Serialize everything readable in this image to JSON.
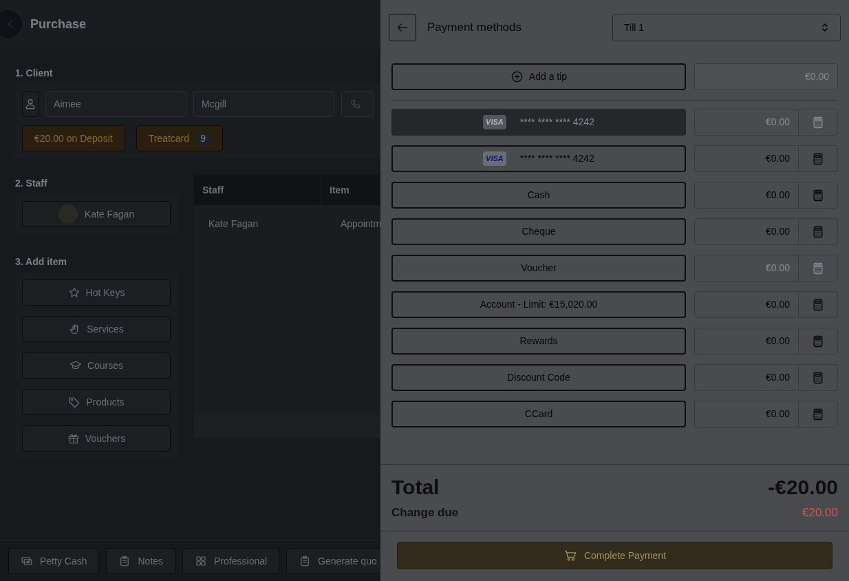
{
  "page": {
    "title": "Purchase",
    "client": {
      "label": "1. Client",
      "first_name": "Aimee",
      "last_name": "Mcgill",
      "badges": [
        {
          "kind": "deposit",
          "text": "€20.00 on Deposit"
        },
        {
          "kind": "count",
          "text": "Treatcard",
          "count": "9"
        }
      ]
    },
    "staff": {
      "label": "2. Staff",
      "member": "Kate Fagan"
    },
    "table": {
      "columns": [
        "Staff",
        "Item"
      ],
      "rows": [
        [
          "Kate Fagan",
          "Appointm"
        ]
      ]
    },
    "add_item": {
      "label": "3. Add item",
      "items": [
        {
          "label": "Hot Keys"
        },
        {
          "label": "Services"
        },
        {
          "label": "Courses"
        },
        {
          "label": "Products"
        },
        {
          "label": "Vouchers"
        }
      ]
    },
    "bottom_bar": [
      {
        "label": "Petty Cash"
      },
      {
        "label": "Notes"
      },
      {
        "label": "Professional"
      },
      {
        "label": "Generate quo"
      }
    ]
  },
  "payment": {
    "title": "Payment methods",
    "till": "Till 1",
    "tip": {
      "label": "Add a tip",
      "amount": "€0.00",
      "disabled": true
    },
    "methods": [
      {
        "kind": "card",
        "brand": "VISA",
        "label": "**** **** **** 4242",
        "amount": "€0.00",
        "disabled": true,
        "amount_disabled": true
      },
      {
        "kind": "card",
        "brand": "VISA",
        "label": "**** **** **** 4242",
        "amount": "€0.00",
        "disabled": false,
        "amount_disabled": false
      },
      {
        "kind": "plain",
        "label": "Cash",
        "amount": "€0.00",
        "disabled": false,
        "amount_disabled": false
      },
      {
        "kind": "plain",
        "label": "Cheque",
        "amount": "€0.00",
        "disabled": false,
        "amount_disabled": false
      },
      {
        "kind": "plain",
        "label": "Voucher",
        "amount": "€0.00",
        "disabled": false,
        "amount_disabled": true
      },
      {
        "kind": "plain",
        "label": "Account - Limit: €15,020.00",
        "amount": "€0.00",
        "disabled": false,
        "amount_disabled": false
      },
      {
        "kind": "plain",
        "label": "Rewards",
        "amount": "€0.00",
        "disabled": false,
        "amount_disabled": false
      },
      {
        "kind": "plain",
        "label": "Discount Code",
        "amount": "€0.00",
        "disabled": false,
        "amount_disabled": false
      },
      {
        "kind": "plain",
        "label": "CCard",
        "amount": "€0.00",
        "disabled": false,
        "amount_disabled": false
      }
    ],
    "total": {
      "label": "Total",
      "value": "-€20.00"
    },
    "change": {
      "label": "Change due",
      "value": "€20.00"
    },
    "complete": "Complete Payment"
  }
}
